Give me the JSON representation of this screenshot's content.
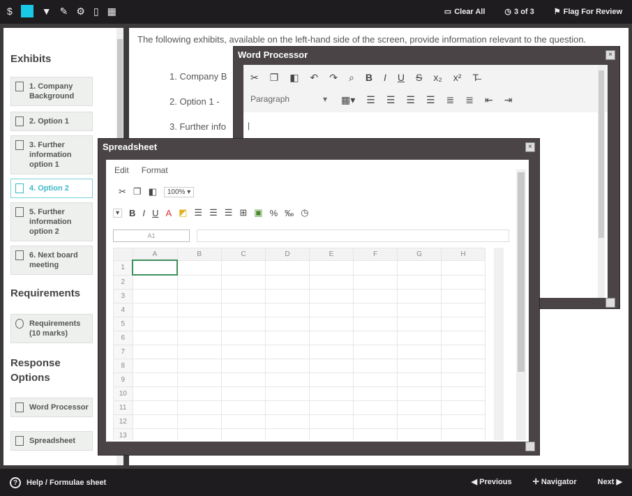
{
  "topbar": {
    "left_icons": [
      "dollar-icon",
      "calculator-icon",
      "flag-small-icon",
      "pencil-icon",
      "gear-icon",
      "document-icon",
      "grid-icon"
    ],
    "clear_all": "Clear All",
    "page_counter": "3 of 3",
    "flag_for_review": "Flag For Review"
  },
  "sidebar": {
    "exhibits_heading": "Exhibits",
    "exhibits": [
      {
        "label": "1. Company Background",
        "active": false
      },
      {
        "label": "2. Option 1",
        "active": false
      },
      {
        "label": "3. Further information option 1",
        "active": false
      },
      {
        "label": "4. Option 2",
        "active": true
      },
      {
        "label": "5. Further information option 2",
        "active": false
      },
      {
        "label": "6. Next board meeting",
        "active": false
      }
    ],
    "requirements_heading": "Requirements",
    "requirements_item": "Requirements (10 marks)",
    "response_heading": "Response Options",
    "response_items": [
      "Word Processor",
      "Spreadsheet"
    ]
  },
  "main": {
    "intro": "The following exhibits, available on the left-hand side of the screen, provide information relevant to the question.",
    "list": [
      "1. Company B",
      "2. Option 1 -",
      "3. Further info"
    ]
  },
  "word_processor": {
    "title": "Word Processor",
    "format_select": "Paragraph",
    "cursor": "|"
  },
  "spreadsheet": {
    "title": "Spreadsheet",
    "menu": [
      "Edit",
      "Format"
    ],
    "zoom": "100%",
    "columns": [
      "A",
      "B",
      "C",
      "D",
      "E",
      "F",
      "G",
      "H"
    ],
    "rows": [
      "1",
      "2",
      "3",
      "4",
      "5",
      "6",
      "7",
      "8",
      "9",
      "10",
      "11",
      "12",
      "13"
    ],
    "cell_ref": "A1"
  },
  "bottombar": {
    "help": "Help / Formulae sheet",
    "previous": "Previous",
    "navigator": "Navigator",
    "next": "Next"
  }
}
